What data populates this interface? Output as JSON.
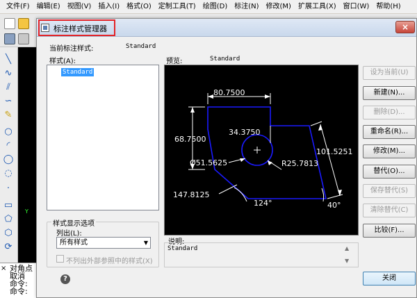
{
  "menubar": {
    "items": [
      "文件(F)",
      "编辑(E)",
      "视图(V)",
      "插入(I)",
      "格式(O)",
      "定制工具(T)",
      "绘图(D)",
      "标注(N)",
      "修改(M)",
      "扩展工具(X)",
      "窗口(W)",
      "帮助(H)"
    ]
  },
  "commandline": {
    "lines": [
      "对角点",
      "取消",
      "命令:",
      "命令:"
    ],
    "close_glyph": "×"
  },
  "ucs": {
    "y_label": "Y"
  },
  "dialog": {
    "title": "标注样式管理器",
    "close_glyph": "×",
    "current_style_label": "当前标注样式:",
    "current_style_value": "Standard",
    "styles_label": "样式(A):",
    "styles": [
      "Standard"
    ],
    "preview_label": "预览:",
    "preview_value": "Standard",
    "display_group_title": "样式显示选项",
    "list_label": "列出(L):",
    "list_value": "所有样式",
    "exclude_xref_label": "不列出外部参照中的样式(X)",
    "description_label": "说明:",
    "description_value": "Standard",
    "buttons": {
      "set_current": "设为当前(U)",
      "new": "新建(N)...",
      "delete": "删除(D)...",
      "rename": "重命名(R)...",
      "modify": "修改(M)...",
      "override": "替代(O)...",
      "save_override": "保存替代(S)",
      "clear_override": "清除替代(C)",
      "compare": "比较(F)..."
    },
    "help_glyph": "?",
    "close_button": "关闭",
    "preview_dims": {
      "top_width": "80.7500",
      "left_height": "68.7500",
      "inner": "34.3750",
      "diameter": "Ø51.5625",
      "radius": "R25.7813",
      "right_side": "101.5251",
      "bottom": "147.8125",
      "angle_bottom": "124°",
      "angle_right": "40°"
    }
  },
  "colors": {
    "highlight_box": "#e32226",
    "preview_outline": "#1a1aff",
    "selection": "#3399ff"
  }
}
